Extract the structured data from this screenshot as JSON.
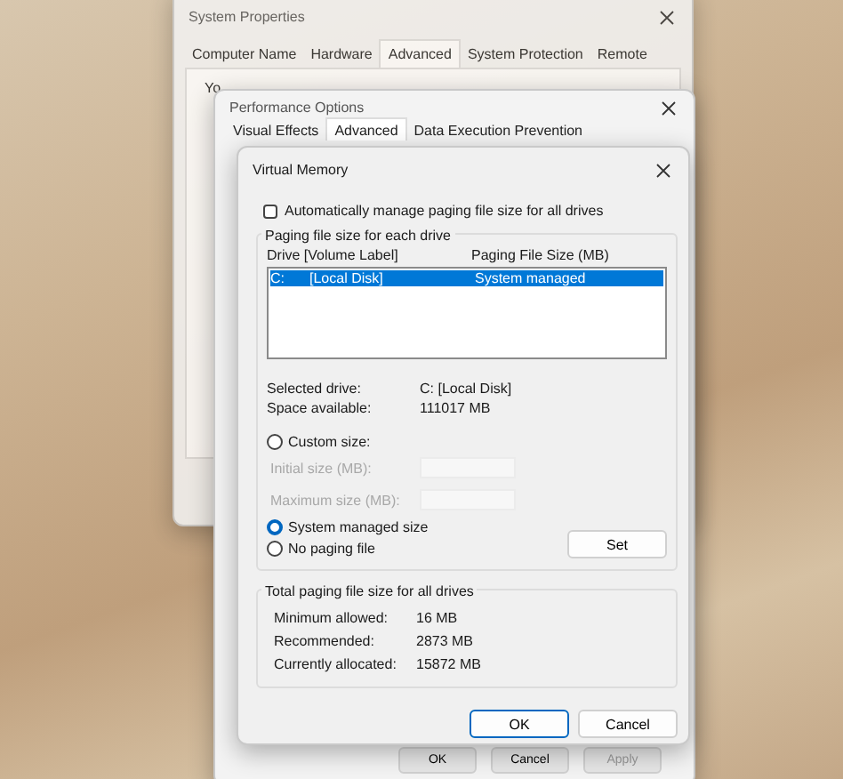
{
  "system_properties": {
    "title": "System Properties",
    "tabs": [
      {
        "label": "Computer Name",
        "selected": false
      },
      {
        "label": "Hardware",
        "selected": false
      },
      {
        "label": "Advanced",
        "selected": true
      },
      {
        "label": "System Protection",
        "selected": false
      },
      {
        "label": "Remote",
        "selected": false
      }
    ],
    "body_text": "Yo"
  },
  "performance_options": {
    "title": "Performance Options",
    "tabs": [
      {
        "label": "Visual Effects",
        "selected": false
      },
      {
        "label": "Advanced",
        "selected": true
      },
      {
        "label": "Data Execution Prevention",
        "selected": false
      }
    ],
    "buttons": [
      {
        "label": "OK",
        "disabled": false
      },
      {
        "label": "Cancel",
        "disabled": false
      },
      {
        "label": "Apply",
        "disabled": true
      }
    ]
  },
  "virtual_memory": {
    "title": "Virtual Memory",
    "auto_manage": {
      "label": "Automatically manage paging file size for all drives",
      "checked": false
    },
    "drives_group": "Paging file size for each drive",
    "columns": [
      "Drive  [Volume Label]",
      "Paging File Size (MB)"
    ],
    "drives": [
      {
        "drive": "C:",
        "volume_label": "[Local Disk]",
        "paging_size": "System managed",
        "selected": true
      }
    ],
    "selected_drive": {
      "label": "Selected drive:",
      "value": "C:  [Local Disk]"
    },
    "space_available": {
      "label": "Space available:",
      "value": "111017 MB"
    },
    "options": [
      {
        "kind": "radio",
        "label": "Custom size:",
        "selected": false
      },
      {
        "kind": "field",
        "label": "Initial size (MB):",
        "disabled": true
      },
      {
        "kind": "field",
        "label": "Maximum size (MB):",
        "disabled": true
      },
      {
        "kind": "radio",
        "label": "System managed size",
        "selected": true
      },
      {
        "kind": "radio",
        "label": "No paging file",
        "selected": false
      }
    ],
    "set_button": "Set",
    "totals": {
      "title": "Total paging file size for all drives",
      "rows": [
        {
          "label": "Minimum allowed:",
          "value": "16 MB"
        },
        {
          "label": "Recommended:",
          "value": "2873 MB"
        },
        {
          "label": "Currently allocated:",
          "value": "15872 MB"
        }
      ]
    },
    "buttons": [
      {
        "label": "OK",
        "default": true
      },
      {
        "label": "Cancel",
        "default": false
      }
    ]
  }
}
